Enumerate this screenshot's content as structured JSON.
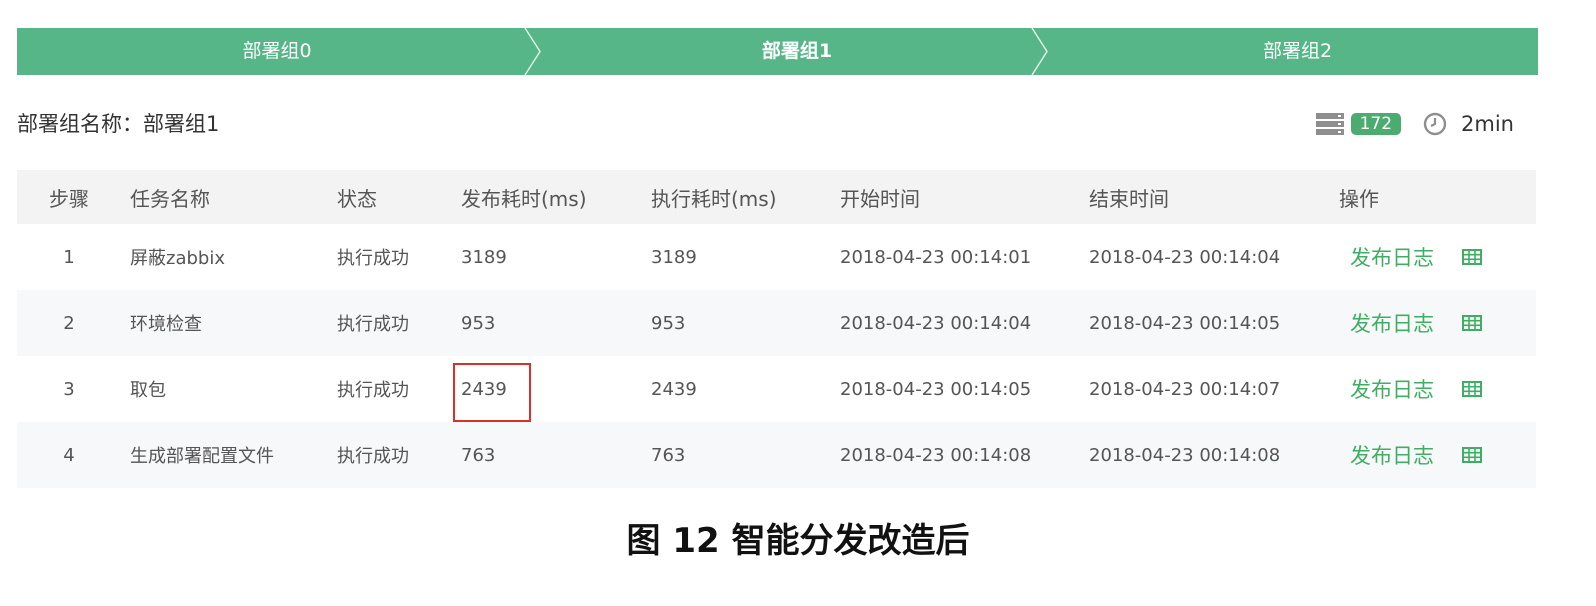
{
  "steps": [
    {
      "label": "部署组0",
      "active": false
    },
    {
      "label": "部署组1",
      "active": true
    },
    {
      "label": "部署组2",
      "active": false
    }
  ],
  "group": {
    "name_label": "部署组名称：部署组1",
    "server_count": "172",
    "duration": "2min",
    "icons": {
      "servers": "server-stack-icon",
      "clock": "clock-icon"
    }
  },
  "table": {
    "headers": {
      "step": "步骤",
      "name": "任务名称",
      "status": "状态",
      "publish_time": "发布耗时(ms)",
      "exec_time": "执行耗时(ms)",
      "start": "开始时间",
      "end": "结束时间",
      "op": "操作"
    },
    "rows": [
      {
        "step": "1",
        "name": "屏蔽zabbix",
        "status": "执行成功",
        "publish_time": "3189",
        "exec_time": "3189",
        "start": "2018-04-23 00:14:01",
        "end": "2018-04-23 00:14:04",
        "op_link": "发布日志"
      },
      {
        "step": "2",
        "name": "环境检查",
        "status": "执行成功",
        "publish_time": "953",
        "exec_time": "953",
        "start": "2018-04-23 00:14:04",
        "end": "2018-04-23 00:14:05",
        "op_link": "发布日志"
      },
      {
        "step": "3",
        "name": "取包",
        "status": "执行成功",
        "publish_time": "2439",
        "exec_time": "2439",
        "start": "2018-04-23 00:14:05",
        "end": "2018-04-23 00:14:07",
        "op_link": "发布日志"
      },
      {
        "step": "4",
        "name": "生成部署配置文件",
        "status": "执行成功",
        "publish_time": "763",
        "exec_time": "763",
        "start": "2018-04-23 00:14:08",
        "end": "2018-04-23 00:14:08",
        "op_link": "发布日志"
      }
    ]
  },
  "colors": {
    "accent": "#56b688",
    "link": "#3fae64",
    "badge": "#4cab6f",
    "highlight": "#d9302b"
  },
  "caption": "图 12 智能分发改造后"
}
